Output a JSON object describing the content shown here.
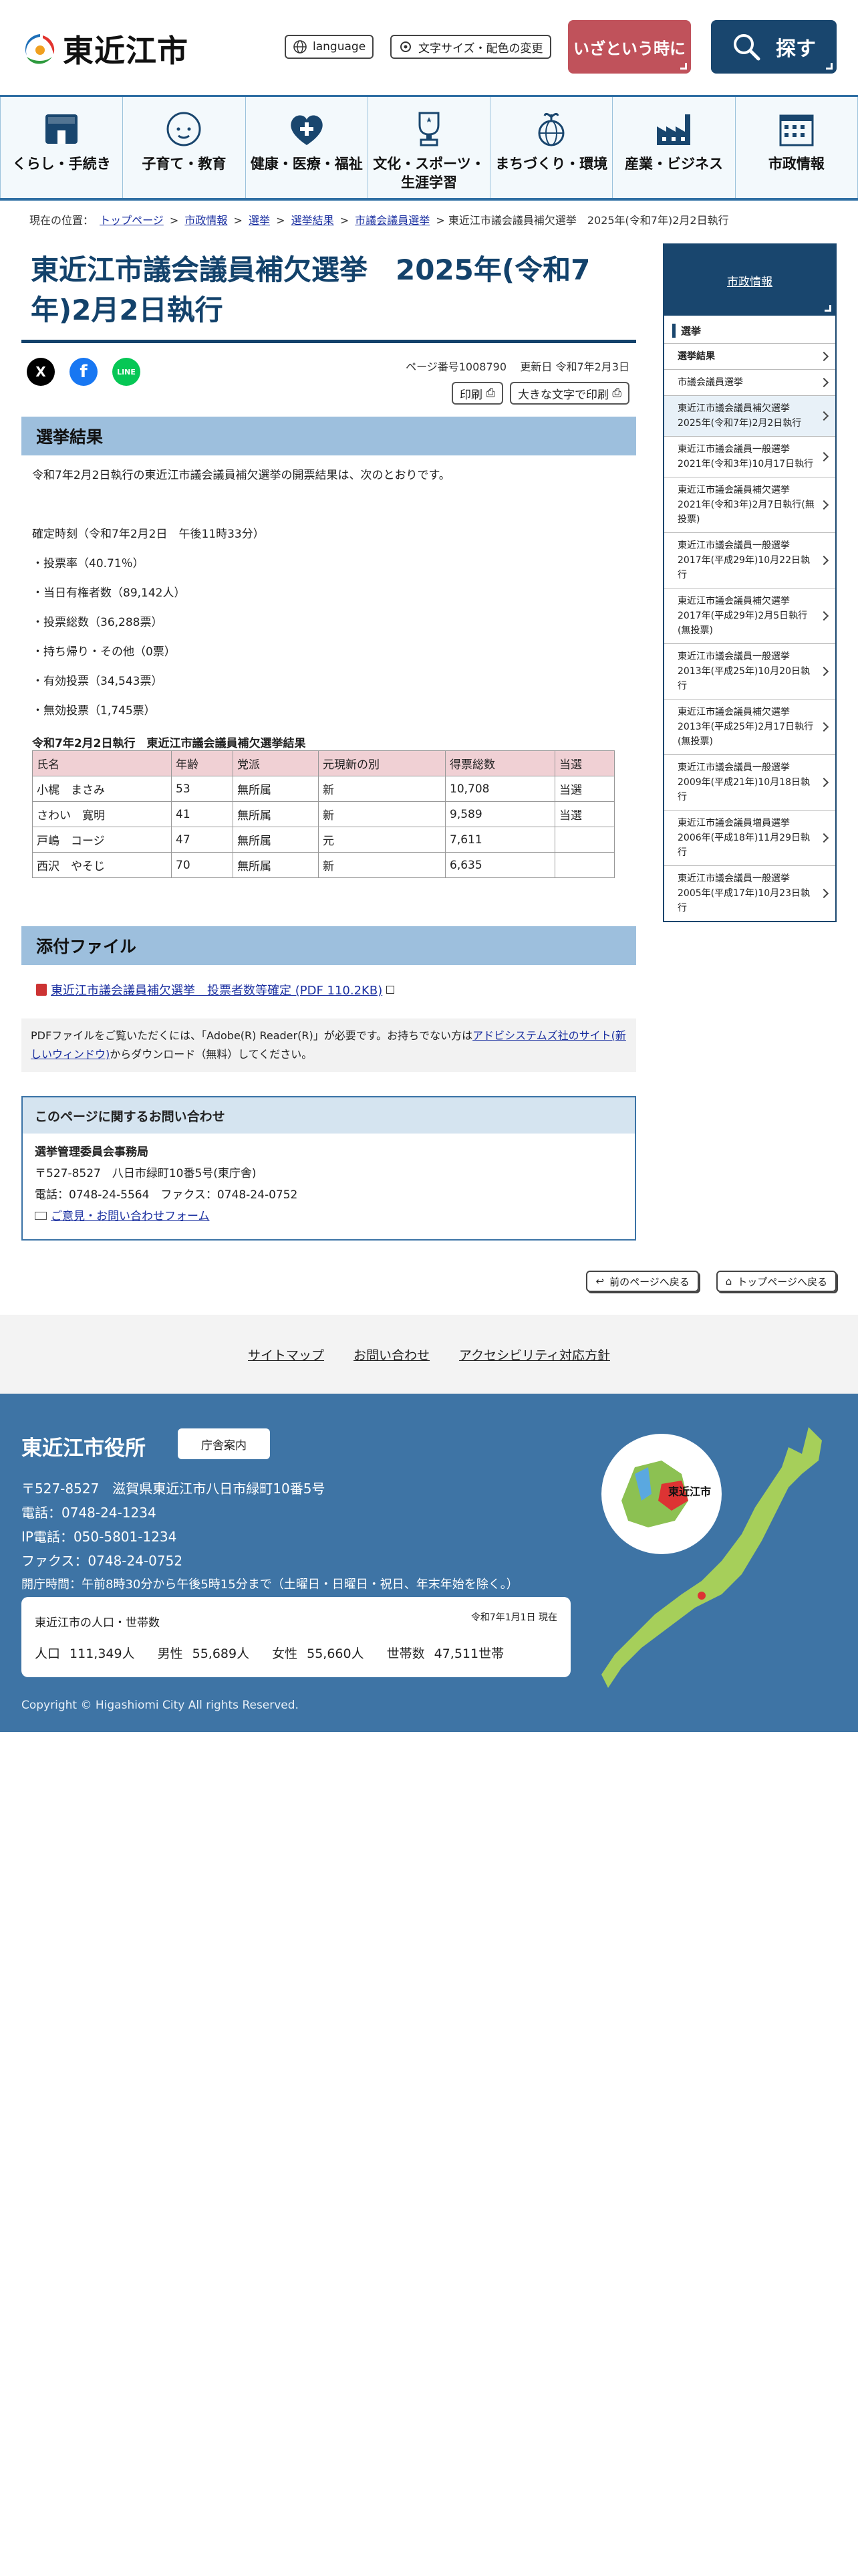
{
  "header": {
    "logo_text": "東近江市",
    "language": "language",
    "font_color": "文字サイズ・配色の変更",
    "emergency": "いざという時に",
    "search": "探す"
  },
  "nav": [
    {
      "label": "くらし・手続き",
      "icon": "house-icon"
    },
    {
      "label": "子育て・教育",
      "icon": "baby-icon"
    },
    {
      "label": "健康・医療・福祉",
      "icon": "heart-plus-icon"
    },
    {
      "label": "文化・スポーツ・生涯学習",
      "icon": "trophy-icon"
    },
    {
      "label": "まちづくり・環境",
      "icon": "globe-sprout-icon"
    },
    {
      "label": "産業・ビジネス",
      "icon": "factory-icon"
    },
    {
      "label": "市政情報",
      "icon": "building-icon"
    }
  ],
  "breadcrumb": {
    "prefix": "現在の位置：",
    "items": [
      "トップページ",
      "市政情報",
      "選挙",
      "選挙結果",
      "市議会議員選挙"
    ],
    "sep": ">",
    "current": "東近江市議会議員補欠選挙　2025年(令和7年)2月2日執行"
  },
  "page": {
    "title": "東近江市議会議員補欠選挙　2025年(令和7年)2月2日執行",
    "page_no": "ページ番号1008790",
    "updated": "更新日 令和7年2月3日",
    "print": "印刷",
    "print_large": "大きな文字で印刷"
  },
  "section1": {
    "heading": "選挙結果",
    "intro": "令和7年2月2日執行の東近江市議会議員補欠選挙の開票結果は、次のとおりです。",
    "lines": [
      "確定時刻（令和7年2月2日　午後11時33分）",
      "・投票率（40.71％）",
      "・当日有権者数（89,142人）",
      "・投票総数（36,288票）",
      "・持ち帰り・その他（0票）",
      "・有効投票（34,543票）",
      "・無効投票（1,745票）"
    ],
    "table_caption": "令和7年2月2日執行　東近江市議会議員補欠選挙結果",
    "table_headers": [
      "氏名",
      "年齢",
      "党派",
      "元現新の別",
      "得票総数",
      "当選"
    ],
    "table_rows": [
      [
        "小梶　まさみ",
        "53",
        "無所属",
        "新",
        "10,708",
        "当選"
      ],
      [
        "さわい　寛明",
        "41",
        "無所属",
        "新",
        "9,589",
        "当選"
      ],
      [
        "戸嶋　コージ",
        "47",
        "無所属",
        "元",
        "7,611",
        ""
      ],
      [
        "西沢　やそじ",
        "70",
        "無所属",
        "新",
        "6,635",
        ""
      ]
    ]
  },
  "attachments": {
    "heading": "添付ファイル",
    "file": "東近江市議会議員補欠選挙　投票者数等確定 (PDF 110.2KB)",
    "note_before": "PDFファイルをご覧いただくには、「Adobe(R) Reader(R)」が必要です。お持ちでない方は",
    "note_link": "アドビシステムズ社のサイト(新しいウィンドウ)",
    "note_after": "からダウンロード（無料）してください。"
  },
  "contact": {
    "heading": "このページに関するお問い合わせ",
    "dept": "選挙管理委員会事務局",
    "addr": "〒527-8527　八日市緑町10番5号(東庁舎)",
    "tel": "電話：0748-24-5564　ファクス：0748-24-0752",
    "form": "ご意見・お問い合わせフォーム"
  },
  "back": {
    "prev": "前のページへ戻る",
    "top": "トップページへ戻る"
  },
  "side": {
    "header": "市政情報",
    "section": "選挙",
    "items": [
      {
        "label": "選挙結果",
        "bold": true,
        "on": false
      },
      {
        "label": "市議会議員選挙",
        "bold": false,
        "on": false
      },
      {
        "label": "東近江市議会議員補欠選挙　2025年(令和7年)2月2日執行",
        "bold": false,
        "on": true
      },
      {
        "label": "東近江市議会議員一般選挙　2021年(令和3年)10月17日執行",
        "bold": false,
        "on": false
      },
      {
        "label": "東近江市議会議員補欠選挙　2021年(令和3年)2月7日執行(無投票)",
        "bold": false,
        "on": false
      },
      {
        "label": "東近江市議会議員一般選挙　2017年(平成29年)10月22日執行",
        "bold": false,
        "on": false
      },
      {
        "label": "東近江市議会議員補欠選挙　2017年(平成29年)2月5日執行(無投票)",
        "bold": false,
        "on": false
      },
      {
        "label": "東近江市議会議員一般選挙　2013年(平成25年)10月20日執行",
        "bold": false,
        "on": false
      },
      {
        "label": "東近江市議会議員補欠選挙　2013年(平成25年)2月17日執行(無投票)",
        "bold": false,
        "on": false
      },
      {
        "label": "東近江市議会議員一般選挙　2009年(平成21年)10月18日執行",
        "bold": false,
        "on": false
      },
      {
        "label": "東近江市議会議員増員選挙　2006年(平成18年)11月29日執行",
        "bold": false,
        "on": false
      },
      {
        "label": "東近江市議会議員一般選挙　2005年(平成17年)10月23日執行",
        "bold": false,
        "on": false
      }
    ]
  },
  "footer_links": [
    "サイトマップ",
    "お問い合わせ",
    "アクセシビリティ対応方針"
  ],
  "footer": {
    "name": "東近江市役所",
    "guide": "庁舎案内",
    "address": "〒527-8527　滋賀県東近江市八日市緑町10番5号",
    "tel": "電話：0748-24-1234",
    "ip": "IP電話：050-5801-1234",
    "fax": "ファクス：0748-24-0752",
    "hours": "開庁時間：午前8時30分から午後5時15分まで（土曜日・日曜日・祝日、年末年始を除く。）",
    "map_label": "東近江市",
    "pop_title": "東近江市の人口・世帯数",
    "pop_date": "令和7年1月1日 現在",
    "pop_total_label": "人口",
    "pop_total": "111,349人",
    "male_label": "男性",
    "male": "55,689人",
    "female_label": "女性",
    "female": "55,660人",
    "hh_label": "世帯数",
    "hh": "47,511世帯",
    "copyright": "Copyright © Higashiomi City All rights Reserved."
  },
  "colors": {
    "navy": "#19466e",
    "emergency": "#c0525b",
    "section": "#9dbfdd",
    "footer": "#3e74a5",
    "table_head": "#f0d0d4"
  }
}
